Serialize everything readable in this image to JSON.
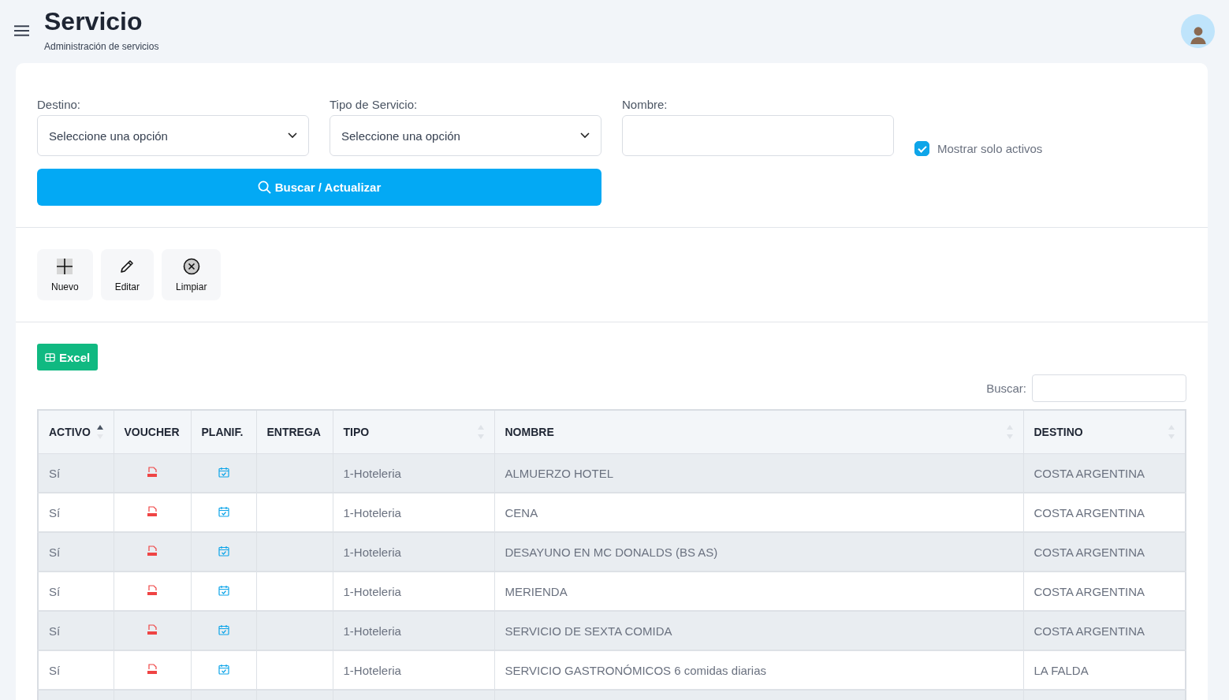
{
  "header": {
    "title": "Servicio",
    "subtitle": "Administración de servicios"
  },
  "filters": [
    {
      "kind": "select",
      "label": "Destino:",
      "value": "Seleccione una opción"
    },
    {
      "kind": "select",
      "label": "Tipo de Servicio:",
      "value": "Seleccione una opción"
    },
    {
      "kind": "text",
      "label": "Nombre:"
    }
  ],
  "only_active": {
    "label": "Mostrar solo activos",
    "checked": true
  },
  "search_button": "Buscar / Actualizar",
  "actions": [
    {
      "kind": "add",
      "label": "Nuevo"
    },
    {
      "kind": "edit",
      "label": "Editar"
    },
    {
      "kind": "clear",
      "label": "Limpiar"
    }
  ],
  "excel_button": "Excel",
  "table_search": {
    "label": "Buscar:"
  },
  "table": {
    "columns": [
      {
        "label": "ACTIVO",
        "sortable": true,
        "sorted": true
      },
      {
        "label": "VOUCHER"
      },
      {
        "label": "PLANIF."
      },
      {
        "label": "ENTREGA"
      },
      {
        "label": "TIPO",
        "sortable": true,
        "sorted": false
      },
      {
        "label": "NOMBRE",
        "sortable": true,
        "sorted": false
      },
      {
        "label": "DESTINO",
        "sortable": true,
        "sorted": false
      }
    ],
    "rows": [
      {
        "activo": "Sí",
        "tipo": "1-Hoteleria",
        "nombre": "ALMUERZO HOTEL",
        "destino": "COSTA ARGENTINA"
      },
      {
        "activo": "Sí",
        "tipo": "1-Hoteleria",
        "nombre": "CENA",
        "destino": "COSTA ARGENTINA"
      },
      {
        "activo": "Sí",
        "tipo": "1-Hoteleria",
        "nombre": "DESAYUNO EN MC DONALDS (BS AS)",
        "destino": "COSTA ARGENTINA"
      },
      {
        "activo": "Sí",
        "tipo": "1-Hoteleria",
        "nombre": "MERIENDA",
        "destino": "COSTA ARGENTINA"
      },
      {
        "activo": "Sí",
        "tipo": "1-Hoteleria",
        "nombre": "SERVICIO DE SEXTA COMIDA",
        "destino": "COSTA ARGENTINA"
      },
      {
        "activo": "Sí",
        "tipo": "1-Hoteleria",
        "nombre": "SERVICIO GASTRONÓMICOS 6 comidas diarias",
        "destino": "LA FALDA"
      }
    ]
  }
}
